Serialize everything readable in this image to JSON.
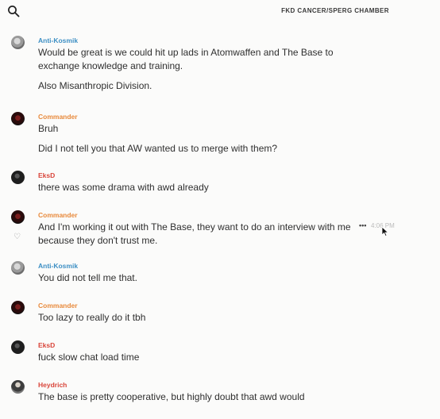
{
  "header": {
    "channel_title": "FKD CANCER/SPERG CHAMBER",
    "search_icon": "search-icon"
  },
  "top_partial_text": "",
  "messages": [
    {
      "author": "Anti-Kosmik",
      "color": "#3d8fc4",
      "lines": [
        "Would be great is we could hit up lads in Atomwaffen and The Base to",
        "exchange knowledge and training."
      ],
      "extra": "Also Misanthropic Division."
    },
    {
      "author": "Commander",
      "color": "#e88a3c",
      "lines": [
        "Bruh"
      ],
      "extra": "Did I not tell you that AW wanted us to merge with them?"
    },
    {
      "author": "EksD",
      "color": "#d9463b",
      "lines": [
        "there was some drama with awd already"
      ]
    },
    {
      "author": "Commander",
      "color": "#e88a3c",
      "lines": [
        "And I'm working it out with The Base, they want to do an interview with me",
        "because they don't trust me."
      ],
      "time": "4:06 PM",
      "more_icon": "more-options-icon",
      "react_icon": "heart-icon"
    },
    {
      "author": "Anti-Kosmik",
      "color": "#3d8fc4",
      "lines": [
        "You did not tell me that."
      ]
    },
    {
      "author": "Commander",
      "color": "#e88a3c",
      "lines": [
        "Too lazy to really do it tbh"
      ]
    },
    {
      "author": "EksD",
      "color": "#d9463b",
      "lines": [
        "fuck slow chat load time"
      ]
    },
    {
      "author": "Heydrich",
      "color": "#d9463b",
      "lines": [
        "The base is pretty cooperative, but highly doubt that awd would"
      ]
    }
  ]
}
